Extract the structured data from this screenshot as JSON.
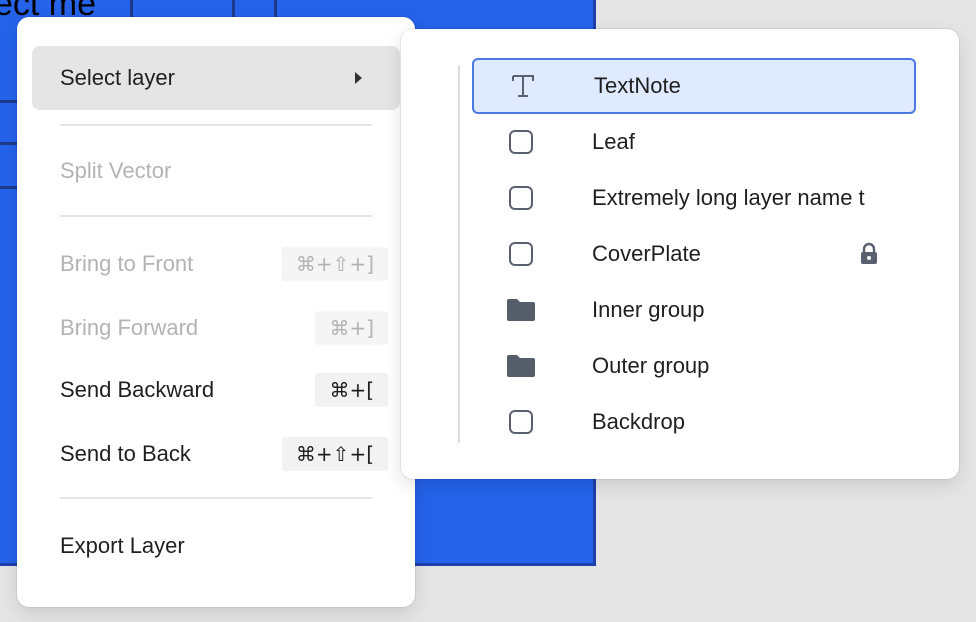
{
  "canvas": {
    "text": "ect me",
    "fill_color": "#2563eb"
  },
  "context_menu": {
    "items": [
      {
        "label": "Select layer",
        "shortcut": "",
        "disabled": false,
        "has_submenu": true,
        "active": true
      },
      {
        "label": "Split Vector",
        "shortcut": "",
        "disabled": true
      },
      {
        "label": "Bring to Front",
        "shortcut": "⌘+⇧+]",
        "disabled": true
      },
      {
        "label": "Bring Forward",
        "shortcut": "⌘+]",
        "disabled": true
      },
      {
        "label": "Send Backward",
        "shortcut": "⌘+[",
        "disabled": false
      },
      {
        "label": "Send to Back",
        "shortcut": "⌘+⇧+[",
        "disabled": false
      },
      {
        "label": "Export Layer",
        "shortcut": "",
        "disabled": false
      }
    ]
  },
  "layer_menu": {
    "selected_color": "#e0eaff",
    "layers": [
      {
        "name": "TextNote",
        "icon": "text-icon",
        "selected": true,
        "locked": false
      },
      {
        "name": "Leaf",
        "icon": "rectangle-icon",
        "selected": false,
        "locked": false
      },
      {
        "name": "Extremely long layer name t",
        "icon": "rectangle-icon",
        "selected": false,
        "locked": false
      },
      {
        "name": "CoverPlate",
        "icon": "rectangle-icon",
        "selected": false,
        "locked": true
      },
      {
        "name": "Inner group",
        "icon": "folder-icon",
        "selected": false,
        "locked": false
      },
      {
        "name": "Outer group",
        "icon": "folder-icon",
        "selected": false,
        "locked": false
      },
      {
        "name": "Backdrop",
        "icon": "rectangle-icon",
        "selected": false,
        "locked": false
      }
    ]
  }
}
